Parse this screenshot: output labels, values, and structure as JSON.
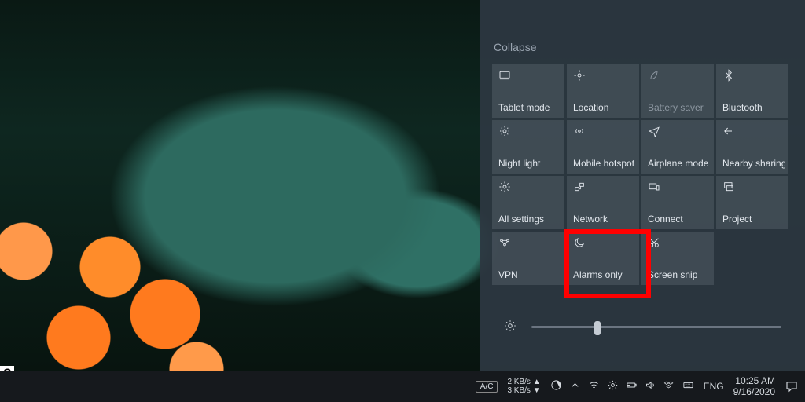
{
  "action_center": {
    "collapse_label": "Collapse",
    "tiles": [
      {
        "id": "tablet-mode",
        "label": "Tablet mode",
        "icon": "tablet-icon"
      },
      {
        "id": "location",
        "label": "Location",
        "icon": "location-icon"
      },
      {
        "id": "battery-saver",
        "label": "Battery saver",
        "icon": "leaf-icon",
        "dim": true
      },
      {
        "id": "bluetooth",
        "label": "Bluetooth",
        "icon": "bluetooth-icon"
      },
      {
        "id": "night-light",
        "label": "Night light",
        "icon": "sun-icon"
      },
      {
        "id": "mobile-hotspot",
        "label": "Mobile hotspot",
        "icon": "antenna-icon"
      },
      {
        "id": "airplane-mode",
        "label": "Airplane mode",
        "icon": "airplane-icon"
      },
      {
        "id": "nearby-sharing",
        "label": "Nearby sharing",
        "icon": "share-icon"
      },
      {
        "id": "all-settings",
        "label": "All settings",
        "icon": "gear-icon"
      },
      {
        "id": "network",
        "label": "Network",
        "icon": "network-icon"
      },
      {
        "id": "connect",
        "label": "Connect",
        "icon": "connect-icon"
      },
      {
        "id": "project",
        "label": "Project",
        "icon": "project-icon"
      },
      {
        "id": "vpn",
        "label": "VPN",
        "icon": "vpn-icon"
      },
      {
        "id": "alarms-only",
        "label": "Alarms only",
        "icon": "moon-icon",
        "highlighted": true
      },
      {
        "id": "screen-snip",
        "label": "Screen snip",
        "icon": "snip-icon"
      }
    ],
    "brightness_percent": 25
  },
  "taskbar": {
    "ac_badge": "A/C",
    "net_up": "2 KB/s ▲",
    "net_down": "3 KB/s ▼",
    "lang": "ENG",
    "time": "10:25 AM",
    "date": "9/16/2020"
  },
  "highlight_color": "#ff0000"
}
